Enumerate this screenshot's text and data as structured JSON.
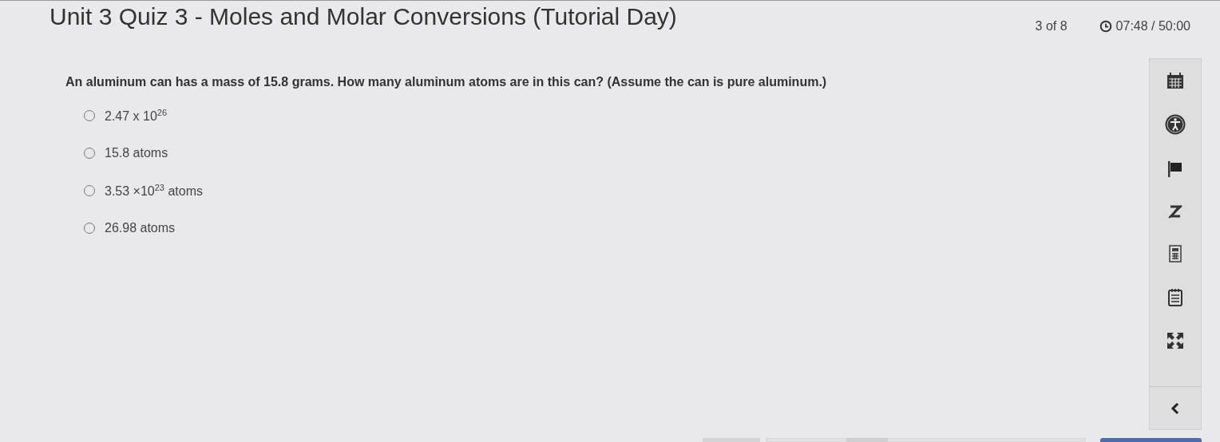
{
  "title": "Unit 3 Quiz 3 - Moles and Molar Conversions (Tutorial Day)",
  "progress": "3 of 8",
  "timer": "07:48 / 50:00",
  "question": "An aluminum can has a mass of 15.8 grams. How many aluminum atoms are in this can? (Assume the can is pure aluminum.)",
  "options": [
    {
      "text": "2.47 x 10$^{26}$",
      "selected": false
    },
    {
      "text": "15.8 atoms",
      "selected": false
    },
    {
      "text": "3.53 ×10$^{23}$ atoms",
      "selected": false
    },
    {
      "text": "26.98 atoms",
      "selected": false
    }
  ],
  "tools": [
    {
      "kind": "calendar"
    },
    {
      "kind": "accessibility"
    },
    {
      "kind": "flag"
    },
    {
      "kind": "strike"
    },
    {
      "kind": "calculator"
    },
    {
      "kind": "notepad"
    },
    {
      "kind": "expand"
    }
  ]
}
